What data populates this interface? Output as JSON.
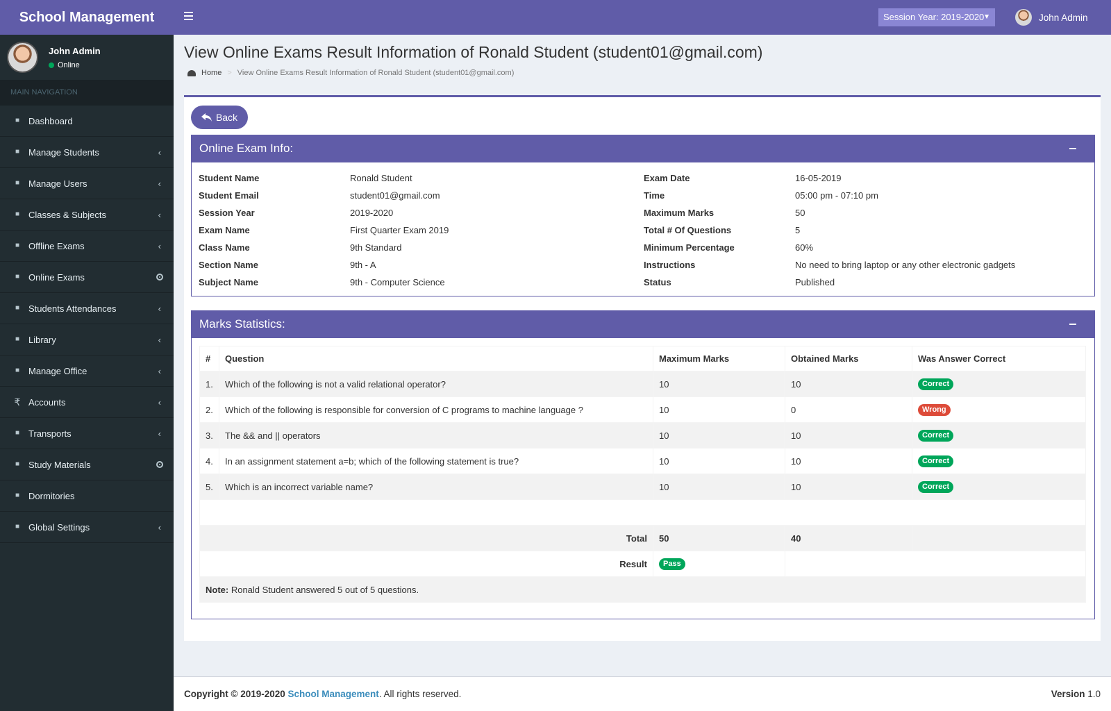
{
  "app": {
    "title": "School Management"
  },
  "sidebar": {
    "user_name": "John Admin",
    "status": "Online",
    "nav_header": "MAIN NAVIGATION",
    "items": [
      {
        "label": "Dashboard",
        "icon": "dashboard-icon"
      },
      {
        "label": "Manage Students",
        "icon": "users-icon"
      },
      {
        "label": "Manage Users",
        "icon": "users-icon"
      },
      {
        "label": "Classes & Subjects",
        "icon": "institution-icon"
      },
      {
        "label": "Offline Exams",
        "icon": "graduation-cap-icon"
      },
      {
        "label": "Online Exams",
        "icon": "search-icon"
      },
      {
        "label": "Students Attendances",
        "icon": "bell-icon"
      },
      {
        "label": "Library",
        "icon": "book-icon"
      },
      {
        "label": "Manage Office",
        "icon": "briefcase-icon"
      },
      {
        "label": "Accounts",
        "icon": "rupee-icon",
        "glyph": "₹"
      },
      {
        "label": "Transports",
        "icon": "bus-icon"
      },
      {
        "label": "Study Materials",
        "icon": "open-book-icon"
      },
      {
        "label": "Dormitories",
        "icon": "building-icon"
      },
      {
        "label": "Global Settings",
        "icon": "gears-icon"
      }
    ]
  },
  "topbar": {
    "session": "Session Year: 2019-2020",
    "user_name": "John Admin"
  },
  "page": {
    "title": "View Online Exams Result Information of Ronald Student (student01@gmail.com)",
    "breadcrumb_home": "Home",
    "breadcrumb_current": "View Online Exams Result Information of Ronald Student (student01@gmail.com)",
    "back_label": "Back"
  },
  "exam_info": {
    "heading": "Online Exam Info:",
    "left": [
      {
        "k": "Student Name",
        "v": "Ronald Student"
      },
      {
        "k": "Student Email",
        "v": "student01@gmail.com"
      },
      {
        "k": "Session Year",
        "v": "2019-2020"
      },
      {
        "k": "Exam Name",
        "v": "First Quarter Exam 2019"
      },
      {
        "k": "Class Name",
        "v": "9th Standard"
      },
      {
        "k": "Section Name",
        "v": "9th - A"
      },
      {
        "k": "Subject Name",
        "v": "9th - Computer Science"
      }
    ],
    "right": [
      {
        "k": "Exam Date",
        "v": "16-05-2019"
      },
      {
        "k": "Time",
        "v": "05:00 pm - 07:10 pm"
      },
      {
        "k": "Maximum Marks",
        "v": "50"
      },
      {
        "k": "Total # Of Questions",
        "v": "5"
      },
      {
        "k": "Minimum Percentage",
        "v": "60%"
      },
      {
        "k": "Instructions",
        "v": "No need to bring laptop or any other electronic gadgets"
      },
      {
        "k": "Status",
        "v": "Published"
      }
    ]
  },
  "marks": {
    "heading": "Marks Statistics:",
    "columns": [
      "#",
      "Question",
      "Maximum Marks",
      "Obtained Marks",
      "Was Answer Correct"
    ],
    "rows": [
      {
        "n": "1.",
        "q": "Which of the following is not a valid relational operator?",
        "max": "10",
        "obt": "10",
        "res": "Correct"
      },
      {
        "n": "2.",
        "q": "Which of the following is responsible for conversion of C programs to machine language ?",
        "max": "10",
        "obt": "0",
        "res": "Wrong"
      },
      {
        "n": "3.",
        "q": "The && and || operators",
        "max": "10",
        "obt": "10",
        "res": "Correct"
      },
      {
        "n": "4.",
        "q": "In an assignment statement a=b; which of the following statement is true?",
        "max": "10",
        "obt": "10",
        "res": "Correct"
      },
      {
        "n": "5.",
        "q": "Which is an incorrect variable name?",
        "max": "10",
        "obt": "10",
        "res": "Correct"
      }
    ],
    "total_label": "Total",
    "total_max": "50",
    "total_obt": "40",
    "result_label": "Result",
    "result_value": "Pass",
    "note_label": "Note:",
    "note_text": " Ronald Student answered 5 out of 5 questions."
  },
  "footer": {
    "copyright": "Copyright © 2019-2020 ",
    "brand": "School Management",
    "rights": ". All rights reserved.",
    "version_label": "Version",
    "version": " 1.0"
  },
  "colors": {
    "brand": "#605ca8",
    "sidebar": "#222d32",
    "success": "#00a65a",
    "danger": "#dd4b39"
  }
}
